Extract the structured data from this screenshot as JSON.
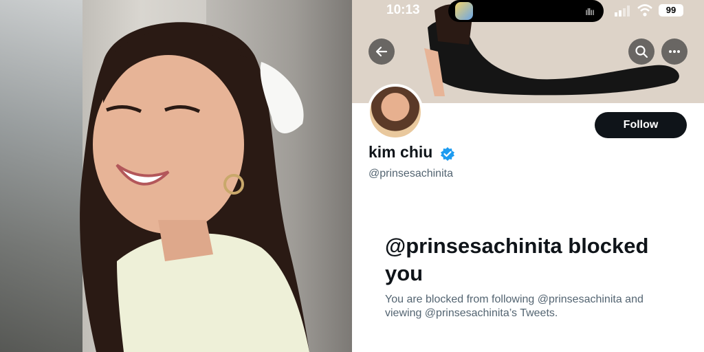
{
  "status_bar": {
    "time": "10:13",
    "battery": "99",
    "icons": [
      "signal-icon",
      "wifi-icon",
      "battery-icon",
      "audio-wave-icon"
    ]
  },
  "profile": {
    "display_name": "kim chiu",
    "handle": "@prinsesachinita",
    "follow_label": "Follow",
    "verified": true
  },
  "blocked": {
    "title": "@prinsesachinita blocked you",
    "body": "You are blocked from following @prinsesachinita and viewing @prinsesachinita’s Tweets."
  },
  "colors": {
    "button_dark": "#0f1419",
    "text_secondary": "#536471",
    "verified_blue": "#1d9bf0"
  },
  "icons": {
    "back": "arrow-left-icon",
    "search": "search-icon",
    "more": "more-horizontal-icon",
    "verified": "verified-badge-icon"
  }
}
